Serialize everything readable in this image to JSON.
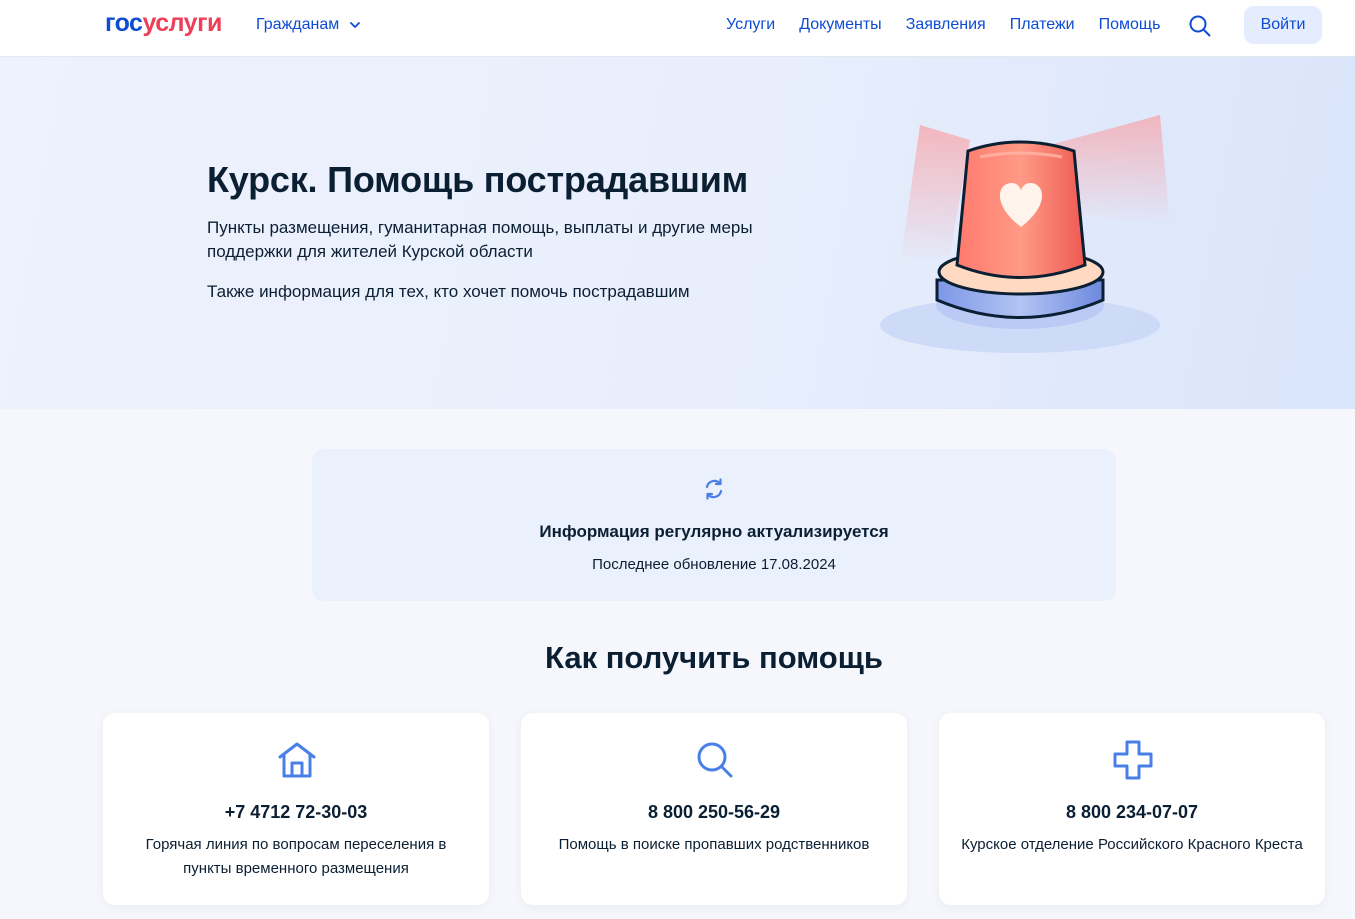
{
  "header": {
    "logo": {
      "part1": "гос",
      "part2": "услуги"
    },
    "audience_label": "Гражданам",
    "nav": [
      "Услуги",
      "Документы",
      "Заявления",
      "Платежи",
      "Помощь"
    ],
    "login_label": "Войти"
  },
  "hero": {
    "title": "Курск. Помощь пострадавшим",
    "description": "Пункты размещения, гуманитарная помощь, выплаты и другие меры поддержки для жителей Курской области",
    "description2": "Также информация для тех, кто хочет помочь пострадавшим"
  },
  "info": {
    "title": "Информация регулярно актуализируется",
    "updated": "Последнее обновление 17.08.2024"
  },
  "help": {
    "title": "Как получить помощь",
    "cards": [
      {
        "icon": "house-icon",
        "phone": "+7 4712 72-30-03",
        "caption": "Горячая линия по вопросам переселения в пункты временного размещения"
      },
      {
        "icon": "search-icon",
        "phone": "8 800 250-56-29",
        "caption": "Помощь в поиске пропавших родственников"
      },
      {
        "icon": "cross-icon",
        "phone": "8 800 234-07-07",
        "caption": "Курское отделение Российского Красного Креста"
      }
    ]
  },
  "colors": {
    "brand_blue": "#0d4cd3",
    "brand_red": "#ee3f58",
    "icon_blue": "#4a7fe8"
  }
}
